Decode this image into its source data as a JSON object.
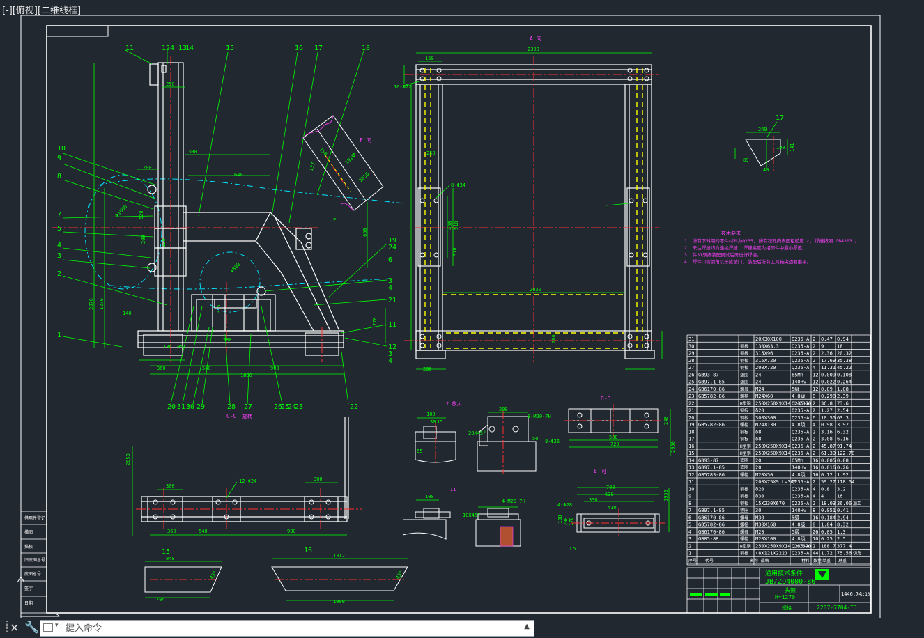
{
  "viewport": {
    "label": "[-][俯视][二维线框]"
  },
  "command": {
    "placeholder": "鍵入命令",
    "history_icon": "triangle-up-icon",
    "close_icon": "close-icon",
    "settings_icon": "wrench-icon"
  },
  "colors": {
    "background": "#212830",
    "line": "#ffffff",
    "dimension": "#00ff00",
    "centerline": "#ff3030",
    "hidden": "#ffff00",
    "chain": "#00e5ff",
    "note": "#ff40ff"
  },
  "views": {
    "main_numbers_top": [
      "11",
      "12",
      "4",
      "13",
      "14",
      "15",
      "16",
      "17",
      "18"
    ],
    "main_numbers_left": [
      "10",
      "9",
      "8",
      "7",
      "5",
      "4",
      "3",
      "2",
      "1"
    ],
    "main_numbers_bottom": [
      "20",
      "31",
      "30",
      "29",
      "28",
      "27",
      "26",
      "25",
      "24",
      "23",
      "22"
    ],
    "main_numbers_right": [
      "19",
      "24",
      "6",
      "3",
      "4",
      "21",
      "11",
      "12",
      "4",
      "3"
    ],
    "a_view_title": "A 向",
    "f_view_title": "F 向",
    "cc_title": "C-C",
    "cc_sub": "旋转",
    "dd_title": "D-D",
    "e_view_title": "E 向",
    "i_title": "I 放大",
    "ii_title": "II",
    "part15": "15",
    "part16": "16",
    "part17": "17",
    "main_dims": [
      "250",
      "300",
      "200",
      "640",
      "2870",
      "1270",
      "140",
      "280",
      "360",
      "540",
      "900",
      "1890",
      "770",
      "315",
      "136",
      "105",
      "Φ1000",
      "Φ800",
      "650",
      "520",
      "200",
      "120"
    ],
    "a_dims": [
      "2300",
      "150",
      "250",
      "8-Φ34",
      "16-Φ22",
      "2030",
      "510",
      "450",
      "370",
      "280",
      "200"
    ],
    "cc_dims": [
      "2050",
      "300",
      "12-Φ24",
      "300",
      "360",
      "540",
      "900"
    ],
    "dd_dims": [
      "580",
      "720",
      "8-Φ26",
      "240",
      "2050"
    ],
    "e_dims": [
      "700",
      "630",
      "330",
      "410",
      "4-Φ28",
      "1950",
      "130",
      "200",
      "170",
      "C5"
    ],
    "i_dims": [
      "100",
      "30",
      "15",
      "65",
      "20X45°",
      "200",
      "8-M20-7H",
      "50",
      "10X45°",
      "4-M20-7H"
    ],
    "part15_dims": [
      "848",
      "704",
      "45°"
    ],
    "part16_dims": [
      "1312",
      "1000",
      "45°"
    ],
    "part17_dims": [
      "249",
      "141",
      "89",
      "100",
      "40"
    ],
    "f_dims": [
      "150",
      "1910",
      "2050",
      "137",
      "5",
      "F"
    ]
  },
  "tech_notes": {
    "title": "技术要求",
    "lines": [
      "1. 所有下料用的零件材料为Q235, 所有铰孔内表面粗糙度 ✓, 焊缝按照 GB4303 。",
      "2. 未注焊缝均为连续焊缝, 焊缝高度为相邻件中最小厚度。",
      "3. 件31须按装配调试后再进行焊接。",
      "4. 焊件口需倒角以形成坡口, 装配后所有工具箱尖边要磨平。"
    ]
  },
  "bom": {
    "rows": [
      [
        "31",
        "",
        "",
        "20X30X100",
        "Q235-A",
        "2",
        "0.47",
        "0.94"
      ],
      [
        "30",
        "",
        "钢板",
        "130X63.3",
        "Q235-A",
        "2",
        "9",
        "18"
      ],
      [
        "29",
        "",
        "钢板",
        "315X96",
        "Q235-A",
        "2",
        "2.36",
        "20.32"
      ],
      [
        "28",
        "",
        "钢板",
        "315X720",
        "Q235-A",
        "2",
        "17.69",
        "35.38"
      ],
      [
        "27",
        "",
        "钢板",
        "200X720",
        "Q235-A",
        "4",
        "11.31",
        "45.22"
      ],
      [
        "26",
        "GB93-87",
        "垫圈",
        "24",
        "65Mn",
        "12",
        "0.009",
        "0.108"
      ],
      [
        "25",
        "GB97.1-85",
        "垫圈",
        "24",
        "140Hv",
        "12",
        "0.022",
        "0.264"
      ],
      [
        "24",
        "GB6170-86",
        "螺母",
        "M24",
        "5级",
        "12",
        "0.09",
        "1.08"
      ],
      [
        "23",
        "GB5782-86",
        "螺栓",
        "M24X60",
        "4.8级",
        "8",
        "0.298",
        "2.39"
      ],
      [
        "22",
        "",
        "H型钢",
        "250X250X9X14 L=2050",
        "Q235-A",
        "2",
        "36.8",
        "73.6"
      ],
      [
        "21",
        "",
        "钢板",
        "δ20",
        "Q235-A",
        "2",
        "1.27",
        "2.54"
      ],
      [
        "20",
        "",
        "钢板",
        "300X300",
        "Q235-A",
        "6",
        "10.55",
        "63.3"
      ],
      [
        "19",
        "GB5782-86",
        "螺栓",
        "M24X130",
        "4.8级",
        "4",
        "0.98",
        "3.92"
      ],
      [
        "18",
        "",
        "钢板",
        "δ8",
        "Q235-A",
        "2",
        "3.16",
        "6.32"
      ],
      [
        "17",
        "",
        "钢板",
        "δ8",
        "Q235-A",
        "2",
        "3.08",
        "6.16"
      ],
      [
        "16",
        "",
        "H型钢",
        "250X250X9X14",
        "Q235-A",
        "2",
        "45.87",
        "91.74"
      ],
      [
        "15",
        "",
        "H型钢",
        "250X250X9X14",
        "Q235-A",
        "2",
        "61.39",
        "122.78"
      ],
      [
        "14",
        "GB93-87",
        "垫圈",
        "20",
        "65Mn",
        "16",
        "0.005",
        "0.08"
      ],
      [
        "13",
        "GB97.1-85",
        "垫圈",
        "20",
        "140Hv",
        "16",
        "0.016",
        "0.26"
      ],
      [
        "12",
        "GB5783-86",
        "螺栓",
        "M20X50",
        "4.8级",
        "16",
        "0.12",
        "1.92"
      ],
      [
        "11",
        "",
        "",
        "200X75X9 L=300",
        "Q235-A",
        "2",
        "59.27",
        "118.54"
      ],
      [
        "10",
        "",
        "钢板",
        "δ20",
        "Q235-A",
        "4",
        "0.8",
        "3.2"
      ],
      [
        "9",
        "",
        "钢板",
        "δ30",
        "Q235-A",
        "4",
        "4",
        "16"
      ],
      [
        "8",
        "",
        "钢板",
        "15X230X670",
        "Q235-A",
        "2",
        "18.03",
        "36.06"
      ],
      [
        "7",
        "GB97.1-85",
        "垫圈",
        "30",
        "140Hv",
        "8",
        "0.051",
        "0.41"
      ],
      [
        "6",
        "GB6170-86",
        "螺母",
        "M30",
        "5级",
        "16",
        "0.184",
        "2.94"
      ],
      [
        "5",
        "GB5782-86",
        "螺栓",
        "M30X160",
        "4.8级",
        "8",
        "1.04",
        "8.32"
      ],
      [
        "4",
        "GB6170-86",
        "螺母",
        "M20",
        "5级",
        "26",
        "0.05",
        "1.3"
      ],
      [
        "3",
        "GB85-88",
        "螺栓",
        "M20X100",
        "4.8级",
        "10",
        "0.25",
        "2.5"
      ],
      [
        "2",
        "",
        "H型钢",
        "250X250X9X14 L=1890",
        "Q235-A",
        "2",
        "188.7",
        "377.4"
      ],
      [
        "1",
        "",
        "钢板",
        "(8X121X222)",
        "Q235-A",
        "44",
        "1.72",
        "75.56"
      ]
    ],
    "header": [
      "序号",
      "代号",
      "",
      "名称 规格",
      "材料",
      "数量",
      "单重",
      "总重"
    ],
    "extra_notes": {
      "row31": "",
      "row8": "加工",
      "row1": "切角"
    }
  },
  "title_block": {
    "standard": "通用技术条件",
    "doc_no": "JB/ZQ4000-86",
    "part_name": "头架",
    "part_sub": "H=1270",
    "weight": "1446.74",
    "scale": "1:10",
    "drawing_no": "2207-7704-TJ",
    "misc": "规格"
  },
  "left_strip": [
    "借用件登记",
    "描图",
    "描校",
    "旧底图总号",
    "底图总号",
    "签字",
    "日期"
  ]
}
